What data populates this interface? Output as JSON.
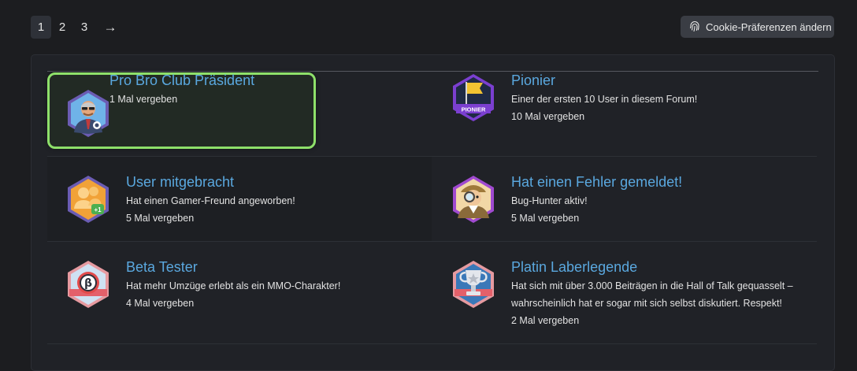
{
  "pagination": {
    "pages": [
      "1",
      "2",
      "3"
    ],
    "next": "→"
  },
  "cookie": {
    "label": "Cookie-Präferenzen ändern",
    "icon": "fingerprint-icon"
  },
  "badges": [
    {
      "title": "Pro Bro Club Präsident",
      "lines": [
        "1 Mal vergeben"
      ],
      "icon": "president-badge-icon"
    },
    {
      "title": "Pionier",
      "lines": [
        "Einer der ersten 10 User in diesem Forum!",
        "10 Mal vergeben"
      ],
      "icon": "pioneer-flag-badge-icon",
      "badge_text": "PIONIER"
    },
    {
      "title": "User mitgebracht",
      "lines": [
        "Hat einen Gamer-Freund angeworben!",
        "5 Mal vergeben"
      ],
      "icon": "users-plus-one-badge-icon",
      "badge_text": "+1"
    },
    {
      "title": "Hat einen Fehler gemeldet!",
      "lines": [
        "Bug-Hunter aktiv!",
        "5 Mal vergeben"
      ],
      "icon": "detective-badge-icon"
    },
    {
      "title": "Beta Tester",
      "lines": [
        "Hat mehr Umzüge erlebt als ein MMO-Charakter!",
        "4 Mal vergeben"
      ],
      "icon": "beta-coin-badge-icon",
      "badge_text": "β"
    },
    {
      "title": "Platin Laberlegende",
      "lines": [
        "Hat sich mit über 3.000 Beiträgen in die Hall of Talk gequasselt –",
        "wahrscheinlich hat er sogar mit sich selbst diskutiert. Respekt!",
        "2 Mal vergeben"
      ],
      "icon": "platinum-trophy-badge-icon"
    }
  ],
  "colors": {
    "background": "#1c1d20",
    "panel": "#202227",
    "link": "#5aa8df",
    "highlight_border": "#8ee06a"
  }
}
